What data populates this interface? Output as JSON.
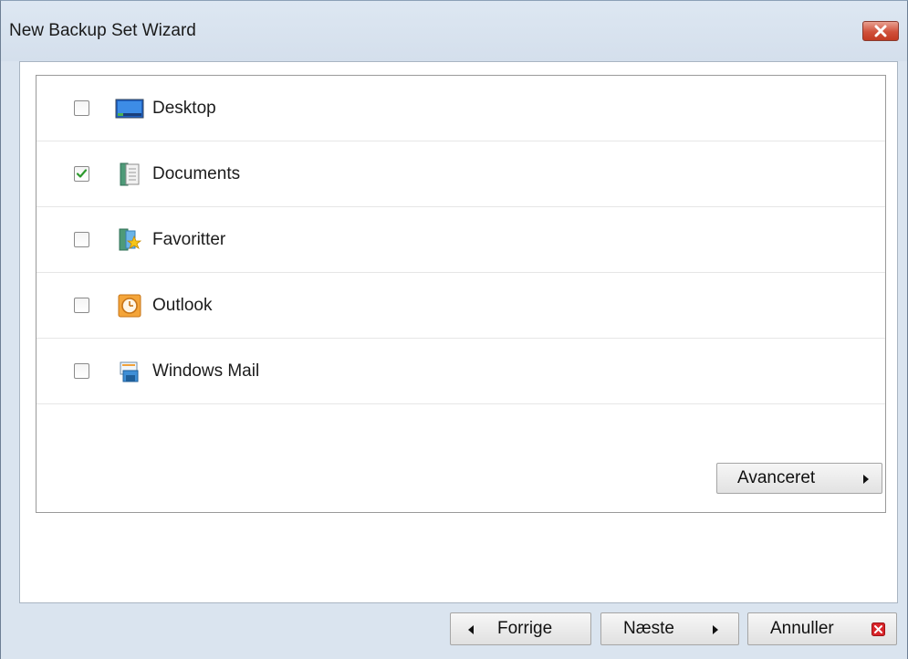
{
  "window": {
    "title": "New Backup Set Wizard"
  },
  "items": [
    {
      "label": "Desktop",
      "checked": false,
      "icon": "desktop-icon"
    },
    {
      "label": "Documents",
      "checked": true,
      "icon": "documents-icon"
    },
    {
      "label": "Favoritter",
      "checked": false,
      "icon": "favorites-icon"
    },
    {
      "label": "Outlook",
      "checked": false,
      "icon": "outlook-icon"
    },
    {
      "label": "Windows Mail",
      "checked": false,
      "icon": "windows-mail-icon"
    }
  ],
  "advanced_button": {
    "label": "Avanceret"
  },
  "footer": {
    "previous_label": "Forrige",
    "next_label": "Næste",
    "cancel_label": "Annuller"
  },
  "colors": {
    "window_bg": "#dae4ef",
    "close_red": "#c8452e",
    "check_green": "#2d9a2d",
    "cancel_icon_red": "#d9262b"
  }
}
